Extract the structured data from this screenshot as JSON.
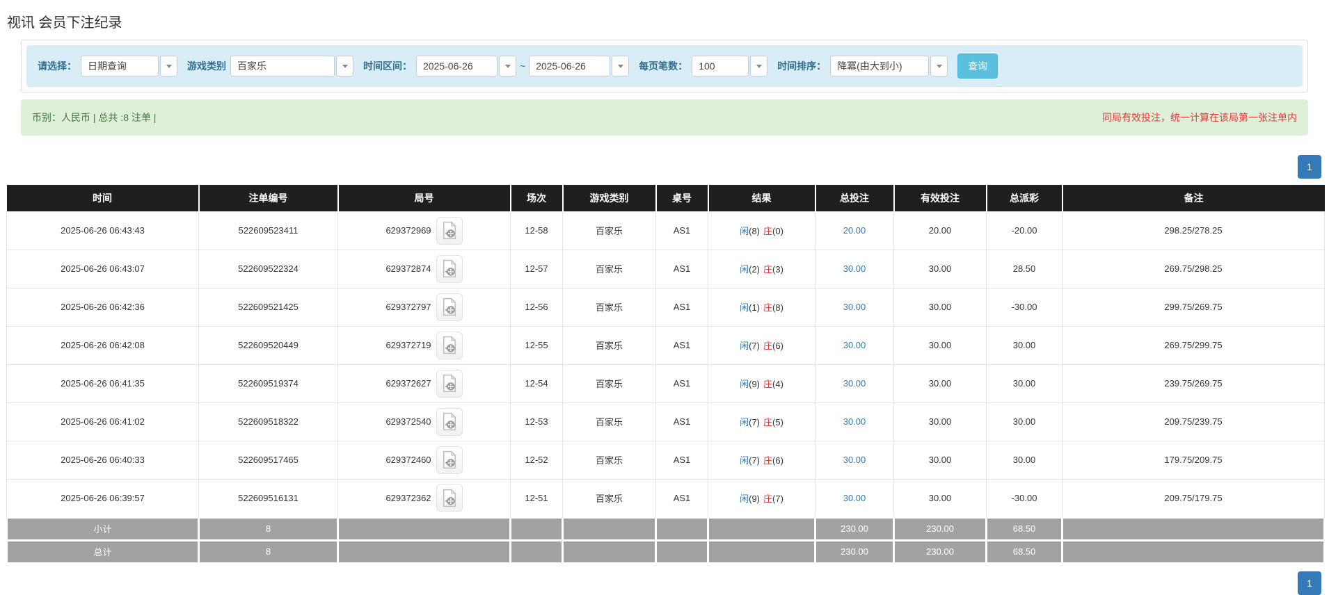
{
  "page": {
    "title": "视讯 会员下注纪录"
  },
  "filter": {
    "select_type": {
      "label": "请选择：",
      "value": "日期查询"
    },
    "game_type": {
      "label": "游戏类别",
      "value": "百家乐"
    },
    "date_range": {
      "label": "时间区间：",
      "from": "2025-06-26",
      "separator": "~",
      "to": "2025-06-26"
    },
    "page_size": {
      "label": "每页笔数：",
      "value": "100"
    },
    "time_sort": {
      "label": "时间排序：",
      "value": "降冪(由大到小)"
    },
    "search_button": "查询"
  },
  "summary": {
    "left": "币别：人民币 | 总共 :8 注单 |",
    "right": "同局有效投注，统一计算在该局第一张注单内"
  },
  "pagination": {
    "page": "1"
  },
  "table": {
    "columns": [
      "时间",
      "注单编号",
      "局号",
      "场次",
      "游戏类别",
      "桌号",
      "结果",
      "总投注",
      "有效投注",
      "总派彩",
      "备注"
    ],
    "result_labels": {
      "player": "闲",
      "banker": "庄"
    },
    "rows": [
      {
        "time": "2025-06-26 06:43:43",
        "bet_id": "522609523411",
        "round_id": "629372969",
        "session": "12-58",
        "game_type": "百家乐",
        "table_no": "AS1",
        "result": {
          "player": "8",
          "banker": "0"
        },
        "total_bet": "20.00",
        "valid_bet": "20.00",
        "payout": "-20.00",
        "remark": "298.25/278.25"
      },
      {
        "time": "2025-06-26 06:43:07",
        "bet_id": "522609522324",
        "round_id": "629372874",
        "session": "12-57",
        "game_type": "百家乐",
        "table_no": "AS1",
        "result": {
          "player": "2",
          "banker": "3"
        },
        "total_bet": "30.00",
        "valid_bet": "30.00",
        "payout": "28.50",
        "remark": "269.75/298.25"
      },
      {
        "time": "2025-06-26 06:42:36",
        "bet_id": "522609521425",
        "round_id": "629372797",
        "session": "12-56",
        "game_type": "百家乐",
        "table_no": "AS1",
        "result": {
          "player": "1",
          "banker": "8"
        },
        "total_bet": "30.00",
        "valid_bet": "30.00",
        "payout": "-30.00",
        "remark": "299.75/269.75"
      },
      {
        "time": "2025-06-26 06:42:08",
        "bet_id": "522609520449",
        "round_id": "629372719",
        "session": "12-55",
        "game_type": "百家乐",
        "table_no": "AS1",
        "result": {
          "player": "7",
          "banker": "6"
        },
        "total_bet": "30.00",
        "valid_bet": "30.00",
        "payout": "30.00",
        "remark": "269.75/299.75"
      },
      {
        "time": "2025-06-26 06:41:35",
        "bet_id": "522609519374",
        "round_id": "629372627",
        "session": "12-54",
        "game_type": "百家乐",
        "table_no": "AS1",
        "result": {
          "player": "9",
          "banker": "4"
        },
        "total_bet": "30.00",
        "valid_bet": "30.00",
        "payout": "30.00",
        "remark": "239.75/269.75"
      },
      {
        "time": "2025-06-26 06:41:02",
        "bet_id": "522609518322",
        "round_id": "629372540",
        "session": "12-53",
        "game_type": "百家乐",
        "table_no": "AS1",
        "result": {
          "player": "7",
          "banker": "5"
        },
        "total_bet": "30.00",
        "valid_bet": "30.00",
        "payout": "30.00",
        "remark": "209.75/239.75"
      },
      {
        "time": "2025-06-26 06:40:33",
        "bet_id": "522609517465",
        "round_id": "629372460",
        "session": "12-52",
        "game_type": "百家乐",
        "table_no": "AS1",
        "result": {
          "player": "7",
          "banker": "6"
        },
        "total_bet": "30.00",
        "valid_bet": "30.00",
        "payout": "30.00",
        "remark": "179.75/209.75"
      },
      {
        "time": "2025-06-26 06:39:57",
        "bet_id": "522609516131",
        "round_id": "629372362",
        "session": "12-51",
        "game_type": "百家乐",
        "table_no": "AS1",
        "result": {
          "player": "9",
          "banker": "7"
        },
        "total_bet": "30.00",
        "valid_bet": "30.00",
        "payout": "-30.00",
        "remark": "209.75/179.75"
      }
    ],
    "footer_rows": [
      {
        "label": "小计",
        "count": "8",
        "total_bet": "230.00",
        "valid_bet": "230.00",
        "payout": "68.50"
      },
      {
        "label": "总计",
        "count": "8",
        "total_bet": "230.00",
        "valid_bet": "230.00",
        "payout": "68.50"
      }
    ],
    "colors": {
      "link_blue": "#337ab7",
      "player_blue": "#337ab7",
      "banker_red": "#e4393c",
      "negative_red": "#ff0000",
      "header_bg": "#1f1f1f",
      "footer_bg": "#a2a2a2",
      "filter_bg": "#d9edf7",
      "summary_bg": "#dff0d8",
      "search_button_bg": "#5bc0de"
    }
  }
}
